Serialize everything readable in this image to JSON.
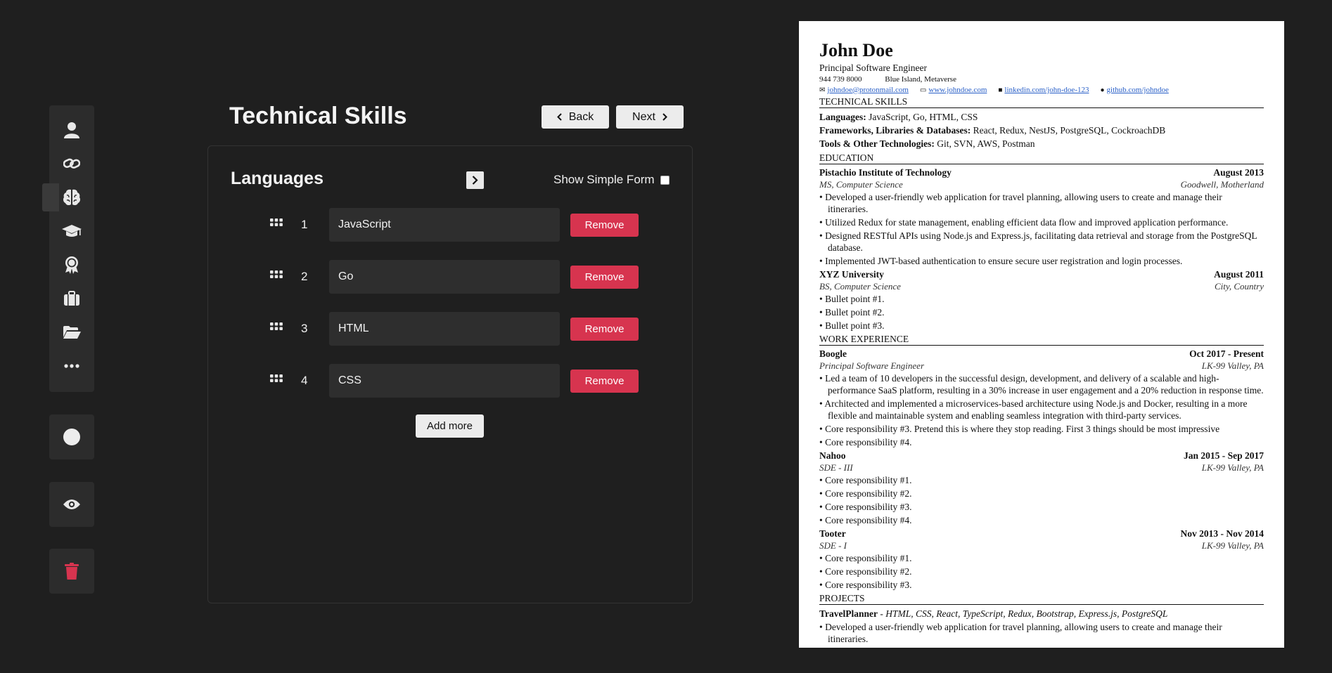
{
  "header": {
    "title": "Technical Skills",
    "back_label": "Back",
    "next_label": "Next"
  },
  "sidebar": {
    "items": [
      {
        "icon": "user-icon"
      },
      {
        "icon": "link-icon"
      },
      {
        "icon": "brain-icon",
        "active": true
      },
      {
        "icon": "graduation-cap-icon"
      },
      {
        "icon": "award-icon"
      },
      {
        "icon": "briefcase-icon"
      },
      {
        "icon": "folder-open-icon"
      },
      {
        "icon": "more-icon"
      }
    ],
    "theme_icon": "circle-icon",
    "preview_icon": "eye-icon",
    "delete_icon": "trash-icon",
    "delete_color": "#d7344f"
  },
  "section": {
    "title": "Languages",
    "simple_form_label": "Show Simple Form",
    "simple_form_checked": false,
    "remove_label": "Remove",
    "add_more_label": "Add more",
    "items": [
      {
        "index": "1",
        "value": "JavaScript"
      },
      {
        "index": "2",
        "value": "Go"
      },
      {
        "index": "3",
        "value": "HTML"
      },
      {
        "index": "4",
        "value": "CSS"
      }
    ]
  },
  "resume": {
    "name": "John Doe",
    "title": "Principal Software Engineer",
    "phone": "944 739 8000",
    "location": "Blue Island, Metaverse",
    "email": "johndoe@protonmail.com",
    "website": "www.johndoe.com",
    "linkedin": "linkedin.com/john-doe-123",
    "github": "github.com/johndoe",
    "skills_heading": "TECHNICAL SKILLS",
    "skills": [
      {
        "label": "Languages:",
        "value": "JavaScript, Go, HTML, CSS"
      },
      {
        "label": "Frameworks, Libraries & Databases:",
        "value": "React, Redux, NestJS, PostgreSQL, CockroachDB"
      },
      {
        "label": "Tools & Other Technologies:",
        "value": "Git, SVN, AWS, Postman"
      }
    ],
    "education_heading": "EDUCATION",
    "education": [
      {
        "school": "Pistachio Institute of Technology",
        "date": "August 2013",
        "degree": "MS, Computer Science",
        "place": "Goodwell, Motherland",
        "bullets": [
          "Developed a user-friendly web application for travel planning, allowing users to create and manage their itineraries.",
          "Utilized Redux for state management, enabling efficient data flow and improved application performance.",
          "Designed RESTful APIs using Node.js and Express.js, facilitating data retrieval and storage from the PostgreSQL database.",
          "Implemented JWT-based authentication to ensure secure user registration and login processes."
        ]
      },
      {
        "school": "XYZ University",
        "date": "August 2011",
        "degree": "BS, Computer Science",
        "place": "City, Country",
        "bullets": [
          "Bullet point #1.",
          "Bullet point #2.",
          "Bullet point #3."
        ]
      }
    ],
    "work_heading": "WORK EXPERIENCE",
    "work": [
      {
        "company": "Boogle",
        "date": "Oct 2017 - Present",
        "role": "Principal Software Engineer",
        "place": "LK-99 Valley, PA",
        "bullets": [
          "Led a team of 10 developers in the successful design, development, and delivery of a scalable and high-performance SaaS platform, resulting in a 30% increase in user engagement and a 20% reduction in response time.",
          "Architected and implemented a microservices-based architecture using Node.js and Docker, resulting in a more flexible and maintainable system and enabling seamless integration with third-party services.",
          "Core responsibility #3. Pretend this is where they stop reading. First 3 things should be most impressive",
          "Core responsibility #4."
        ]
      },
      {
        "company": "Nahoo",
        "date": "Jan 2015 - Sep 2017",
        "role": "SDE - III",
        "place": "LK-99 Valley, PA",
        "bullets": [
          "Core responsibility #1.",
          "Core responsibility #2.",
          "Core responsibility #3.",
          "Core responsibility #4."
        ]
      },
      {
        "company": "Tooter",
        "date": "Nov 2013 - Nov 2014",
        "role": "SDE - I",
        "place": "LK-99 Valley, PA",
        "bullets": [
          "Core responsibility #1.",
          "Core responsibility #2.",
          "Core responsibility #3."
        ]
      }
    ],
    "projects_heading": "PROJECTS",
    "projects": [
      {
        "name": "TravelPlanner",
        "stack": "HTML, CSS, React, TypeScript, Redux, Bootstrap, Express.js, PostgreSQL",
        "bullets": [
          "Developed a user-friendly web application for travel planning, allowing users to create and manage their itineraries."
        ]
      }
    ]
  },
  "colors": {
    "background": "#1f1f1f",
    "panel_border": "#333333",
    "remove_button": "#d7344f",
    "link": "#2a60c8"
  }
}
